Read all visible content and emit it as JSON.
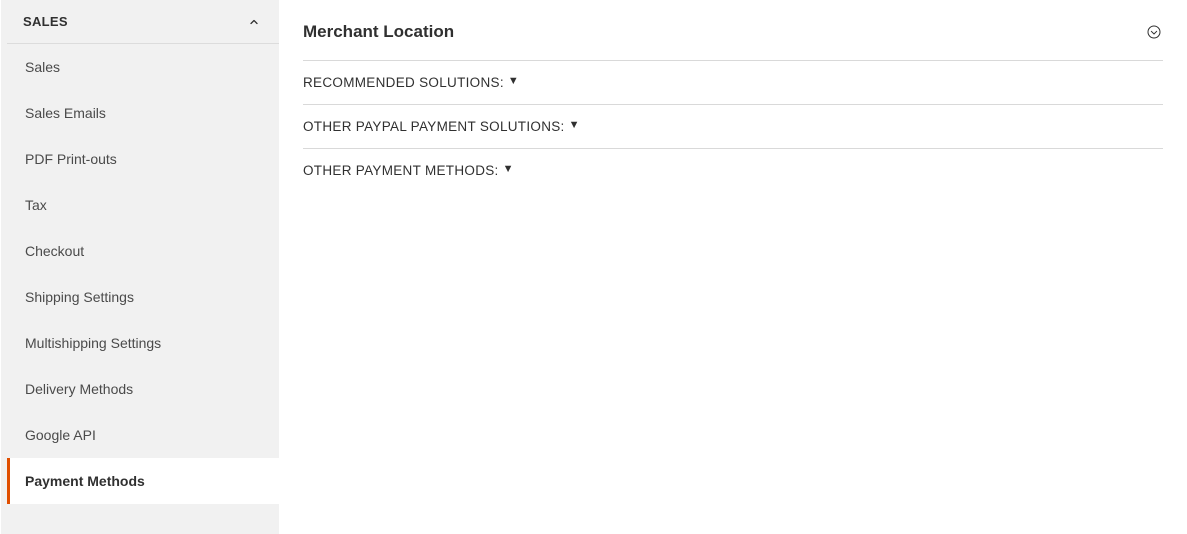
{
  "sidebar": {
    "header": "SALES",
    "items": [
      {
        "label": "Sales"
      },
      {
        "label": "Sales Emails"
      },
      {
        "label": "PDF Print-outs"
      },
      {
        "label": "Tax"
      },
      {
        "label": "Checkout"
      },
      {
        "label": "Shipping Settings"
      },
      {
        "label": "Multishipping Settings"
      },
      {
        "label": "Delivery Methods"
      },
      {
        "label": "Google API"
      },
      {
        "label": "Payment Methods"
      }
    ]
  },
  "main": {
    "merchant_location": "Merchant Location",
    "recommended_solutions": "RECOMMENDED SOLUTIONS:",
    "other_paypal": "OTHER PAYPAL PAYMENT SOLUTIONS:",
    "other_methods": "OTHER PAYMENT METHODS:"
  }
}
